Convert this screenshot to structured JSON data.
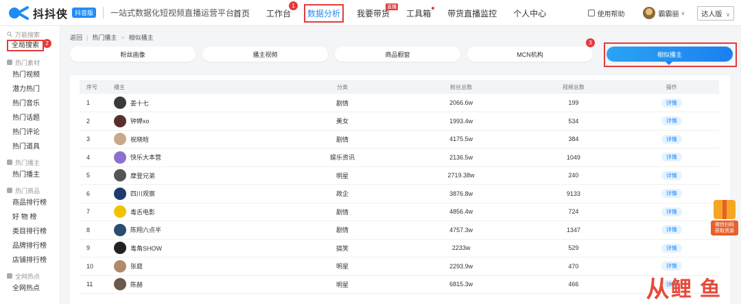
{
  "header": {
    "logo_name": "抖抖侠",
    "logo_tag": "抖音版",
    "slogan": "一站式数据化短视频直播运营平台",
    "nav": [
      {
        "label": "首页"
      },
      {
        "label": "工作台",
        "marker": "1"
      },
      {
        "label": "数据分析",
        "active": true
      },
      {
        "label": "我要带货",
        "badge": "直播"
      },
      {
        "label": "工具箱"
      },
      {
        "label": "带货直播监控"
      },
      {
        "label": "个人中心"
      }
    ],
    "help": "使用帮助",
    "user_name": "霸霸丽",
    "version": "达人版"
  },
  "sidebar": {
    "search_group": "万能搜索",
    "global_search": "全局搜索",
    "global_search_marker": "2",
    "materials_group": "热门素材",
    "materials": [
      "热门视频",
      "潜力热门",
      "热门音乐",
      "热门话题",
      "热门评论",
      "热门道具"
    ],
    "anchors_group": "热门播主",
    "anchors": [
      "热门播主"
    ],
    "goods_group": "热门商品",
    "goods": [
      "商品排行榜",
      "好 物 榜",
      "类目排行榜",
      "品牌排行榜",
      "店铺排行榜"
    ],
    "hot_group": "全网热点",
    "hot": [
      "全网热点"
    ]
  },
  "breadcrumb": [
    "返回",
    "热门播主",
    "相似播主"
  ],
  "tabs": [
    {
      "label": "粉丝画像"
    },
    {
      "label": "播主视频"
    },
    {
      "label": "商品橱窗"
    },
    {
      "label": "MCN机构"
    },
    {
      "label": "相似播主",
      "active": true
    }
  ],
  "tab_marker": "3",
  "table": {
    "headers": [
      "序号",
      "播主",
      "分类",
      "粉丝总数",
      "视频总数",
      "操作"
    ],
    "rows": [
      {
        "rank": "1",
        "name": "姜十七",
        "category": "剧情",
        "fans": "2066.6w",
        "videos": "199",
        "action": "详情",
        "avatar": "#3a3a3a"
      },
      {
        "rank": "2",
        "name": "钟婷xo",
        "category": "美女",
        "fans": "1993.4w",
        "videos": "534",
        "action": "详情",
        "avatar": "#5a2e2e"
      },
      {
        "rank": "3",
        "name": "祝晓晗",
        "category": "剧情",
        "fans": "4175.5w",
        "videos": "384",
        "action": "详情",
        "avatar": "#c9a88a"
      },
      {
        "rank": "4",
        "name": "快乐大本营",
        "category": "娱乐资讯",
        "fans": "2136.5w",
        "videos": "1049",
        "action": "详情",
        "avatar": "#8d6fd1"
      },
      {
        "rank": "5",
        "name": "摩登兄弟",
        "category": "明星",
        "fans": "2719.38w",
        "videos": "240",
        "action": "详情",
        "avatar": "#555555"
      },
      {
        "rank": "6",
        "name": "四川观察",
        "category": "政企",
        "fans": "3876.8w",
        "videos": "9133",
        "action": "详情",
        "avatar": "#1f3a6b"
      },
      {
        "rank": "7",
        "name": "毒舌电影",
        "category": "剧情",
        "fans": "4856.4w",
        "videos": "724",
        "action": "详情",
        "avatar": "#f2c200"
      },
      {
        "rank": "8",
        "name": "陈翔六点半",
        "category": "剧情",
        "fans": "4757.3w",
        "videos": "1347",
        "action": "详情",
        "avatar": "#2b4c6f"
      },
      {
        "rank": "9",
        "name": "毒角SHOW",
        "category": "搞笑",
        "fans": "2233w",
        "videos": "529",
        "action": "详情",
        "avatar": "#222222"
      },
      {
        "rank": "10",
        "name": "张庭",
        "category": "明星",
        "fans": "2293.9w",
        "videos": "470",
        "action": "详情",
        "avatar": "#b08a6a"
      },
      {
        "rank": "11",
        "name": "陈赫",
        "category": "明星",
        "fans": "6815.3w",
        "videos": "466",
        "action": "详情",
        "avatar": "#6b5a4a"
      }
    ]
  },
  "promo": {
    "text": "微信扫码\n获取资源"
  },
  "watermark": {
    "mark": "从",
    "text": "鲤 鱼"
  }
}
